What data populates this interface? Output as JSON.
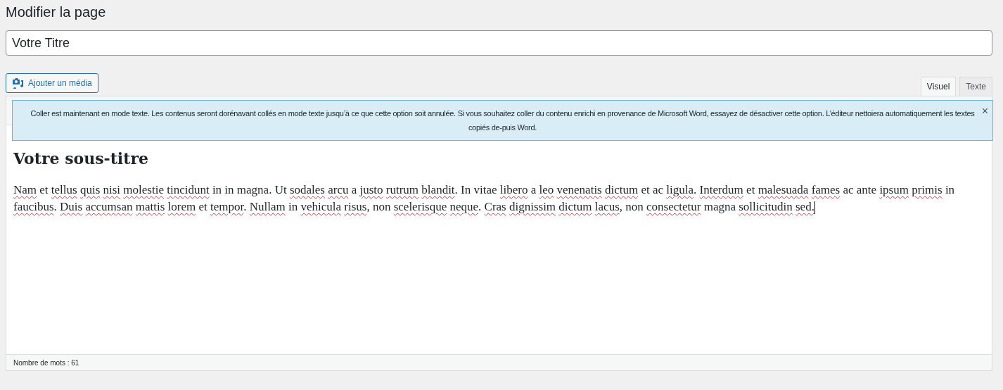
{
  "page_title": "Modifier la page",
  "title_field": {
    "value": "Votre Titre"
  },
  "media_button": {
    "label": "Ajouter un média"
  },
  "tabs": [
    {
      "label": "Visuel",
      "selected": true
    },
    {
      "label": "Texte",
      "selected": false
    }
  ],
  "notice": {
    "text": "Coller est maintenant en mode texte. Les contenus seront dorénavant collés en mode texte jusqu’à ce que cette option soit annulée. Si vous souhaitez coller du contenu enrichi en provenance de Microsoft Word, essayez de désactiver cette option. L’éditeur nettoiera automatiquement les textes copiés de-puis Word.",
    "close": "×"
  },
  "content": {
    "heading": "Votre sous-titre",
    "words": [
      {
        "w": "Nam",
        "misspelled": true
      },
      {
        "w": "et",
        "misspelled": false
      },
      {
        "w": "tellus",
        "misspelled": true
      },
      {
        "w": "quis",
        "misspelled": true
      },
      {
        "w": "nisi",
        "misspelled": true
      },
      {
        "w": "molestie",
        "misspelled": true
      },
      {
        "w": "tincidunt",
        "misspelled": true
      },
      {
        "w": "in in magna. Ut",
        "misspelled": false
      },
      {
        "w": "sodales",
        "misspelled": true
      },
      {
        "w": "arcu",
        "misspelled": true
      },
      {
        "w": "a",
        "misspelled": false
      },
      {
        "w": "justo",
        "misspelled": true
      },
      {
        "w": "rutrum",
        "misspelled": true
      },
      {
        "w": "blandit",
        "misspelled": true,
        "punct": "."
      },
      {
        "w": "In vitae",
        "misspelled": false
      },
      {
        "w": "libero",
        "misspelled": true
      },
      {
        "w": "a",
        "misspelled": false
      },
      {
        "w": "leo",
        "misspelled": true
      },
      {
        "w": "venenatis",
        "misspelled": true
      },
      {
        "w": "dictum",
        "misspelled": true
      },
      {
        "w": "et ac",
        "misspelled": false
      },
      {
        "w": "ligula",
        "misspelled": true,
        "punct": "."
      },
      {
        "w": "Interdum",
        "misspelled": true
      },
      {
        "w": "et",
        "misspelled": false
      },
      {
        "w": "malesuada",
        "misspelled": true
      },
      {
        "w": "fames",
        "misspelled": true
      },
      {
        "w": "ac ante",
        "misspelled": false
      },
      {
        "w": "ipsum",
        "misspelled": true
      },
      {
        "w": "primis",
        "misspelled": true
      },
      {
        "w": "in",
        "misspelled": false
      },
      {
        "w": "faucibus",
        "misspelled": true,
        "punct": "."
      },
      {
        "w": "Duis",
        "misspelled": true
      },
      {
        "w": "accumsan",
        "misspelled": true
      },
      {
        "w": "mattis",
        "misspelled": true
      },
      {
        "w": "lorem",
        "misspelled": true
      },
      {
        "w": "et",
        "misspelled": false
      },
      {
        "w": "tempor",
        "misspelled": true,
        "punct": "."
      },
      {
        "w": "Nullam",
        "misspelled": true
      },
      {
        "w": "in",
        "misspelled": false
      },
      {
        "w": "vehicula",
        "misspelled": true
      },
      {
        "w": "risus",
        "misspelled": true,
        "punct": ","
      },
      {
        "w": "non",
        "misspelled": false
      },
      {
        "w": "scelerisque",
        "misspelled": true
      },
      {
        "w": "neque",
        "misspelled": true,
        "punct": "."
      },
      {
        "w": "Cras",
        "misspelled": true
      },
      {
        "w": "dignissim",
        "misspelled": true
      },
      {
        "w": "dictum",
        "misspelled": true
      },
      {
        "w": "lacus",
        "misspelled": true,
        "punct": ","
      },
      {
        "w": "non",
        "misspelled": false
      },
      {
        "w": "consectetur",
        "misspelled": true
      },
      {
        "w": "magna",
        "misspelled": false
      },
      {
        "w": "sollicitudin",
        "misspelled": true
      },
      {
        "w": "sed.",
        "misspelled": true
      }
    ]
  },
  "status_bar": {
    "word_count": "Nombre de mots : 61"
  }
}
